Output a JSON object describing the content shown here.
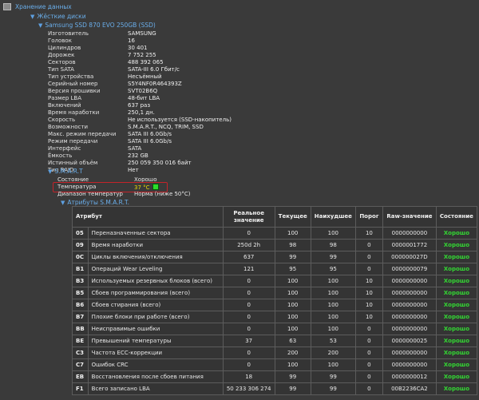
{
  "tree": {
    "root": "Хранение данных",
    "disks": "Жёсткие диски",
    "drive": "Samsung SSD 870 EVO 250GB (SSD)",
    "smart": "S.M.A.R.T",
    "attrs": "Атрибуты S.M.A.R.T."
  },
  "properties": [
    {
      "k": "Изготовитель",
      "v": "SAMSUNG"
    },
    {
      "k": "Головок",
      "v": "16"
    },
    {
      "k": "Цилиндров",
      "v": "30 401"
    },
    {
      "k": "Дорожек",
      "v": "7 752 255"
    },
    {
      "k": "Секторов",
      "v": "488 392 065"
    },
    {
      "k": "Тип SATA",
      "v": "SATA-III 6.0 Гбит/с"
    },
    {
      "k": "Тип устройства",
      "v": "Несъёмный"
    },
    {
      "k": "Серийный номер",
      "v": "S5Y4NF0R464393Z"
    },
    {
      "k": "Версия прошивки",
      "v": "SVT02B6Q"
    },
    {
      "k": "Размер LBA",
      "v": "48-бит LBA"
    },
    {
      "k": "Включений",
      "v": "637 раз"
    },
    {
      "k": "Время наработки",
      "v": "250,1 дн."
    },
    {
      "k": "Скорость",
      "v": "Не используется (SSD-накопитель)"
    },
    {
      "k": "Возможности",
      "v": "S.M.A.R.T., NCQ, TRIM, SSD"
    },
    {
      "k": "Макс. режим передачи",
      "v": "SATA III 6.0Gb/s"
    },
    {
      "k": "Режим передачи",
      "v": "SATA III 6.0Gb/s"
    },
    {
      "k": "Интерфейс",
      "v": "SATA"
    },
    {
      "k": "Ёмкость",
      "v": "232 GB"
    },
    {
      "k": "Истинный объём",
      "v": "250 059 350 016 байт"
    },
    {
      "k": "Тип RAID",
      "v": "Нет"
    }
  ],
  "smart": {
    "state_k": "Состояние",
    "state_v": "Хорошо",
    "temp_k": "Температура",
    "temp_v": "37 °C",
    "range_k": "Диапазон температур",
    "range_v": "Норма (ниже 50°C)"
  },
  "table": {
    "headers": {
      "attr": "Атрибут",
      "real": "Реальное значение",
      "cur": "Текущее",
      "worst": "Наихудшее",
      "thr": "Порог",
      "raw": "Raw-значение",
      "state": "Состояние"
    },
    "rows": [
      {
        "id": "05",
        "name": "Переназначенные сектора",
        "real": "0",
        "cur": "100",
        "worst": "100",
        "thr": "10",
        "raw": "0000000000",
        "state": "Хорошо"
      },
      {
        "id": "09",
        "name": "Время наработки",
        "real": "250d 2h",
        "cur": "98",
        "worst": "98",
        "thr": "0",
        "raw": "0000001772",
        "state": "Хорошо"
      },
      {
        "id": "0C",
        "name": "Циклы включения/отключения",
        "real": "637",
        "cur": "99",
        "worst": "99",
        "thr": "0",
        "raw": "000000027D",
        "state": "Хорошо"
      },
      {
        "id": "B1",
        "name": "Операций Wear Leveling",
        "real": "121",
        "cur": "95",
        "worst": "95",
        "thr": "0",
        "raw": "0000000079",
        "state": "Хорошо"
      },
      {
        "id": "B3",
        "name": "Используемых резервных блоков (всего)",
        "real": "0",
        "cur": "100",
        "worst": "100",
        "thr": "10",
        "raw": "0000000000",
        "state": "Хорошо"
      },
      {
        "id": "B5",
        "name": "Сбоев программирования (всего)",
        "real": "0",
        "cur": "100",
        "worst": "100",
        "thr": "10",
        "raw": "0000000000",
        "state": "Хорошо"
      },
      {
        "id": "B6",
        "name": "Сбоев стирания (всего)",
        "real": "0",
        "cur": "100",
        "worst": "100",
        "thr": "10",
        "raw": "0000000000",
        "state": "Хорошо"
      },
      {
        "id": "B7",
        "name": "Плохие блоки при работе (всего)",
        "real": "0",
        "cur": "100",
        "worst": "100",
        "thr": "10",
        "raw": "0000000000",
        "state": "Хорошо"
      },
      {
        "id": "BB",
        "name": "Неисправимые ошибки",
        "real": "0",
        "cur": "100",
        "worst": "100",
        "thr": "0",
        "raw": "0000000000",
        "state": "Хорошо"
      },
      {
        "id": "BE",
        "name": "Превышений температуры",
        "real": "37",
        "cur": "63",
        "worst": "53",
        "thr": "0",
        "raw": "0000000025",
        "state": "Хорошо"
      },
      {
        "id": "C3",
        "name": "Частота ECC-коррекции",
        "real": "0",
        "cur": "200",
        "worst": "200",
        "thr": "0",
        "raw": "0000000000",
        "state": "Хорошо"
      },
      {
        "id": "C7",
        "name": "Ошибок CRC",
        "real": "0",
        "cur": "100",
        "worst": "100",
        "thr": "0",
        "raw": "0000000000",
        "state": "Хорошо"
      },
      {
        "id": "EB",
        "name": "Восстановления после сбоев питания",
        "real": "18",
        "cur": "99",
        "worst": "99",
        "thr": "0",
        "raw": "0000000012",
        "state": "Хорошо"
      },
      {
        "id": "F1",
        "name": "Всего записано LBA",
        "real": "50 233 306 274",
        "cur": "99",
        "worst": "99",
        "thr": "0",
        "raw": "00B2236CA2",
        "state": "Хорошо"
      }
    ]
  }
}
